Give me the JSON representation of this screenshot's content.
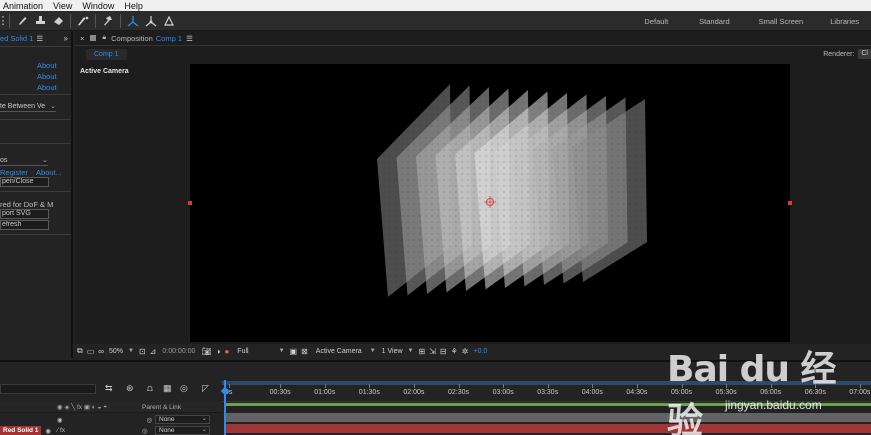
{
  "menu": [
    "Animation",
    "View",
    "Window",
    "Help"
  ],
  "toolbar": {
    "tools": [
      "brush-icon",
      "clone-stamp-icon",
      "eraser-icon",
      "roto-brush-icon",
      "puppet-pin-icon",
      "local-axis-icon",
      "world-axis-icon",
      "view-axis-icon"
    ],
    "workspaces": [
      "Default",
      "Standard",
      "Small Screen",
      "Libraries"
    ]
  },
  "left_panel": {
    "tab": "ed Solid 1",
    "about_links": [
      "About",
      "About",
      "About"
    ],
    "dropdown1": "te Between Ve",
    "dropdown2": "os",
    "register_link": "Register",
    "about_link": "About...",
    "button1": "pen/Close",
    "label_dof": "red for DoF & M",
    "button2": "port SVG",
    "button3": "efresh"
  },
  "comp_panel": {
    "label": "Composition",
    "comp_name": "Comp 1",
    "sub_tab": "Comp 1",
    "renderer_label": "Renderer:",
    "renderer_value": "Cl",
    "active_camera": "Active Camera",
    "viewer_toolbar": {
      "zoom": "50%",
      "timecode": "0:00:00:00",
      "resolution": "Full",
      "view": "Active Camera",
      "layout": "1 View",
      "exposure": "+0.0"
    }
  },
  "timeline": {
    "ticks": [
      "0s",
      "00:30s",
      "01:00s",
      "01:30s",
      "02:00s",
      "02:30s",
      "03:00s",
      "03:30s",
      "04:00s",
      "04:30s",
      "05:00s",
      "05:30s",
      "06:00s",
      "06:30s",
      "07:00s"
    ],
    "parent_header": "Parent & Link",
    "layer_name": "Red Solid 1",
    "parent_values": [
      "None",
      "None"
    ]
  },
  "watermark": {
    "main": "Bai du 经验",
    "sub": "jingyan.baidu.com"
  },
  "colors": {
    "accent": "#2d8ceb",
    "layer_label": "#a33232",
    "track_green": "#6aa34f",
    "track_red": "#b53838"
  }
}
